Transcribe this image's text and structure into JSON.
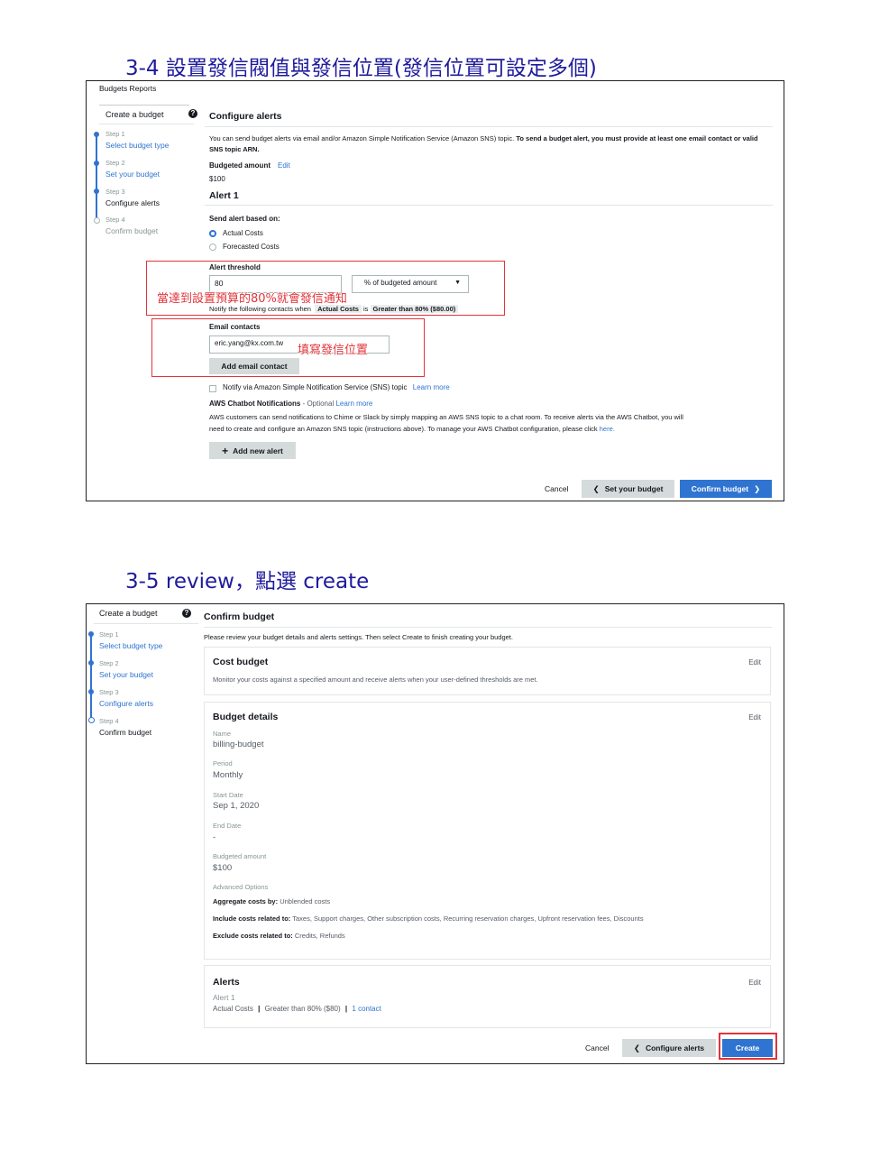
{
  "headings": {
    "h1": "3-4  設置發信閥值與發信位置(發信位置可設定多個)",
    "h2": "3-5 review，點選 create"
  },
  "shot1": {
    "breadcrumb": "Budgets Reports",
    "sidebar_title": "Create a budget",
    "steps": [
      {
        "step": "Step 1",
        "label": "Select budget type"
      },
      {
        "step": "Step 2",
        "label": "Set your budget"
      },
      {
        "step": "Step 3",
        "label": "Configure alerts"
      },
      {
        "step": "Step 4",
        "label": "Confirm budget"
      }
    ],
    "page_title": "Configure alerts",
    "intro_normal": "You can send budget alerts via email and/or Amazon Simple Notification Service (Amazon SNS) topic.",
    "intro_bold_1": "To send a budget alert, you must provide at least one",
    "intro_bold_2": "email contact or valid SNS topic ARN.",
    "budgeted_amount_label": "Budgeted amount",
    "edit_link": "Edit",
    "budgeted_amount_value": "$100",
    "alert_title": "Alert 1",
    "send_alert_label": "Send alert based on:",
    "radio_actual": "Actual Costs",
    "radio_forecasted": "Forecasted Costs",
    "threshold_label": "Alert threshold",
    "threshold_value": "80",
    "threshold_unit": "% of budgeted amount",
    "notify_text": "Notify the following contacts when",
    "notify_chip_1": "Actual Costs",
    "notify_is": "is",
    "notify_chip_2": "Greater than 80% ($80.00)",
    "annotation_threshold": "當達到設置預算的80%就會發信通知",
    "email_label": "Email contacts",
    "email_value": "eric.yang@kx.com.tw",
    "annotation_email": "填寫發信位置",
    "add_email_button": "Add email contact",
    "sns_checkbox_label": "Notify via Amazon Simple Notification Service (SNS) topic",
    "learn_more": "Learn more",
    "chatbot_title": "AWS Chatbot Notifications",
    "chatbot_optional": " - Optional ",
    "chatbot_desc_1": "AWS customers can send notifications to Chime or Slack by simply mapping an AWS SNS topic to a chat room. To receive alerts via the AWS Chatbot, you will",
    "chatbot_desc_2": "need to create and configure an Amazon SNS topic (instructions above). To manage your AWS Chatbot configuration, please click",
    "chatbot_here": "here.",
    "add_alert_button": "Add new alert",
    "cancel": "Cancel",
    "back_button": "Set your budget",
    "next_button": "Confirm budget"
  },
  "shot2": {
    "sidebar_title": "Create a budget",
    "steps": [
      {
        "step": "Step 1",
        "label": "Select budget type"
      },
      {
        "step": "Step 2",
        "label": "Set your budget"
      },
      {
        "step": "Step 3",
        "label": "Configure alerts"
      },
      {
        "step": "Step 4",
        "label": "Confirm budget"
      }
    ],
    "page_title": "Confirm budget",
    "intro": "Please review your budget details and alerts settings. Then select Create to finish creating your budget.",
    "cost_budget_title": "Cost budget",
    "cost_budget_desc": "Monitor your costs against a specified amount and receive alerts when your user-defined thresholds are met.",
    "edit": "Edit",
    "details_title": "Budget details",
    "name_label": "Name",
    "name_value": "billing-budget",
    "period_label": "Period",
    "period_value": "Monthly",
    "start_label": "Start Date",
    "start_value": "Sep 1, 2020",
    "end_label": "End Date",
    "end_value": "-",
    "amount_label": "Budgeted amount",
    "amount_value": "$100",
    "advanced_label": "Advanced Options",
    "aggregate_label": "Aggregate costs by:",
    "aggregate_value": "Unblended costs",
    "include_label": "Include costs related to:",
    "include_value": "Taxes, Support charges, Other subscription costs, Recurring reservation charges, Upfront reservation fees, Discounts",
    "exclude_label": "Exclude costs related to:",
    "exclude_value": "Credits, Refunds",
    "alerts_title": "Alerts",
    "alert_name": "Alert 1",
    "alert_cond_1": "Actual Costs",
    "alert_cond_2": "Greater than 80% ($80)",
    "alert_contacts": "1 contact",
    "cancel": "Cancel",
    "back_button": "Configure alerts",
    "create_button": "Create"
  },
  "colors": {
    "heading": "#1f1b9c",
    "accent": "#2f74d0",
    "annotation_red": "#e0353b"
  }
}
